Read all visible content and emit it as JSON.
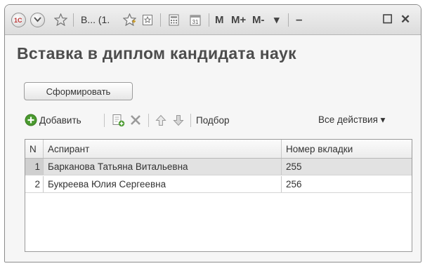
{
  "titlebar": {
    "tab_text": "В... (1.",
    "m_label": "M",
    "mplus_label": "M+",
    "mminus_label": "M-",
    "dropdown_glyph": "▾",
    "minimize_glyph": "–",
    "maximize_glyph": "☐",
    "close_glyph": "✕"
  },
  "page": {
    "title": "Вставка в диплом кандидата наук"
  },
  "buttons": {
    "form_label": "Сформировать"
  },
  "toolbar": {
    "add_label": "Добавить",
    "selection_label": "Подбор",
    "all_actions_label": "Все действия ▾"
  },
  "table": {
    "columns": [
      "N",
      "Аспирант",
      "Номер вкладки"
    ],
    "rows": [
      {
        "n": "1",
        "student": "Барканова Татьяна Витальевна",
        "insert_number": "255",
        "selected": true
      },
      {
        "n": "2",
        "student": "Букреева Юлия Сергеевна",
        "insert_number": "256",
        "selected": false
      }
    ]
  },
  "colors": {
    "titlebar_bg": "#dcdcdc",
    "selected_row_bg": "#e2e2e2",
    "add_icon_green": "#4a9a2f"
  }
}
